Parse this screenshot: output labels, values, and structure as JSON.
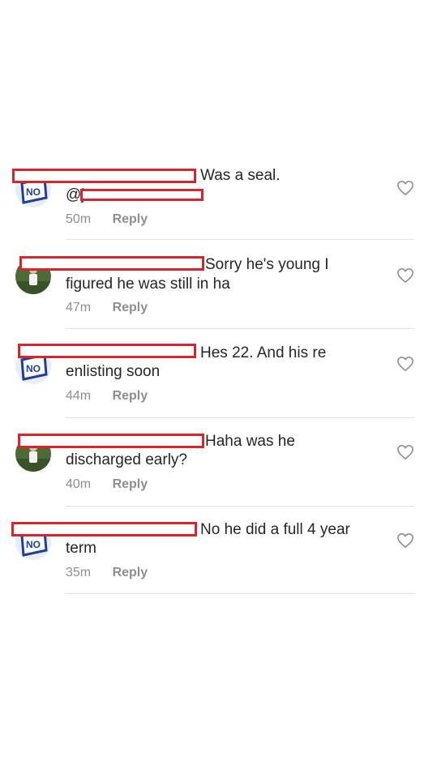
{
  "comments": [
    {
      "text_line1": "Was a seal.",
      "text_line2": "@j",
      "time": "50m",
      "reply_label": "Reply",
      "avatar": "blue-white-badge-avatar"
    },
    {
      "text_line1": "Sorry he's young I",
      "text_line2": "figured he was still in ha",
      "time": "47m",
      "reply_label": "Reply",
      "avatar": "green-outdoor-photo-avatar"
    },
    {
      "text_line1": "Hes 22. And his re",
      "text_line2": "enlisting soon",
      "time": "44m",
      "reply_label": "Reply",
      "avatar": "blue-white-badge-avatar"
    },
    {
      "text_line1": "Haha was he",
      "text_line2": "discharged early?",
      "time": "40m",
      "reply_label": "Reply",
      "avatar": "green-outdoor-photo-avatar"
    },
    {
      "text_line1": "No he did a full 4 year",
      "text_line2": "term",
      "time": "35m",
      "reply_label": "Reply",
      "avatar": "blue-white-badge-avatar"
    }
  ],
  "icons": {
    "like": "heart-outline-icon"
  },
  "colors": {
    "redaction": "#d9242b",
    "meta_text": "#8e8e8e",
    "divider": "#e3e3e3"
  }
}
